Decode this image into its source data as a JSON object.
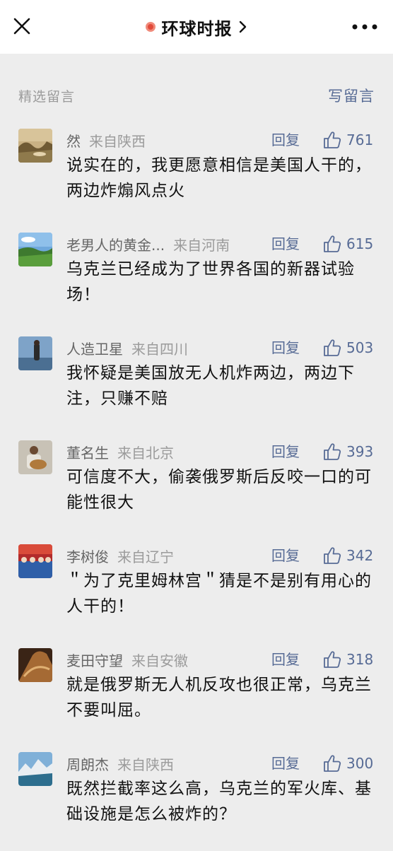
{
  "header": {
    "title": "环球时报",
    "close_icon": "close-icon",
    "more_icon": "more-icon",
    "chevron_icon": "chevron-right-icon"
  },
  "section": {
    "label": "精选留言",
    "write_label": "写留言"
  },
  "colors": {
    "link": "#576b95",
    "background": "#ededed",
    "header_bg": "#ffffff",
    "muted": "#9b9b9b"
  },
  "comments": [
    {
      "nick": "然",
      "location": "来自陕西",
      "reply": "回复",
      "likes": "761",
      "text": "说实在的，我更愿意相信是美国人干的，两边炸煽风点火"
    },
    {
      "nick": "老男人的黄金...",
      "location": "来自河南",
      "reply": "回复",
      "likes": "615",
      "text": "乌克兰已经成为了世界各国的新器试验场！"
    },
    {
      "nick": "人造卫星",
      "location": "来自四川",
      "reply": "回复",
      "likes": "503",
      "text": "我怀疑是美国放无人机炸两边，两边下注，只赚不赔"
    },
    {
      "nick": "董名生",
      "location": "来自北京",
      "reply": "回复",
      "likes": "393",
      "text": "可信度不大，偷袭俄罗斯后反咬一口的可能性很大"
    },
    {
      "nick": "李树俊",
      "location": "来自辽宁",
      "reply": "回复",
      "likes": "342",
      "text": "＂为了克里姆林宫＂猜是不是别有用心的人干的！"
    },
    {
      "nick": "麦田守望",
      "location": "来自安徽",
      "reply": "回复",
      "likes": "318",
      "text": "就是俄罗斯无人机反攻也很正常，乌克兰不要叫屈。"
    },
    {
      "nick": "周朗杰",
      "location": "来自陕西",
      "reply": "回复",
      "likes": "300",
      "text": "既然拦截率这么高，乌克兰的军火库、基础设施是怎么被炸的？"
    }
  ]
}
